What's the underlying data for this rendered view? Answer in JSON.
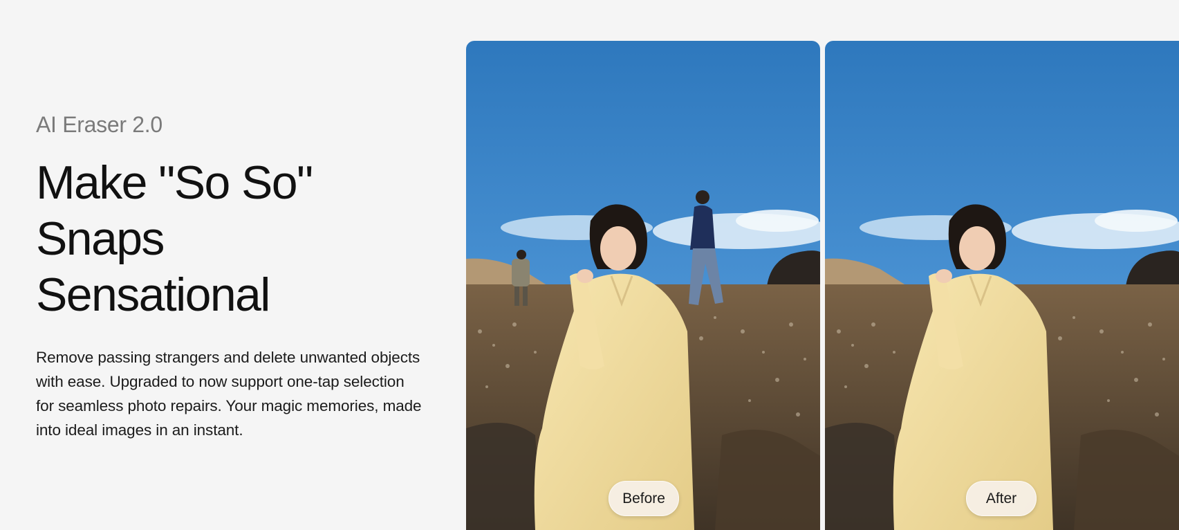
{
  "hero": {
    "eyebrow": "AI Eraser 2.0",
    "headline": [
      "Make \"So So\"",
      "Snaps",
      "Sensational"
    ],
    "description": "Remove passing strangers and delete unwanted objects with ease. Upgraded to now support one-tap selection for seamless photo repairs. Your magic memories, made into ideal images in an instant."
  },
  "comparison": {
    "before_label": "Before",
    "after_label": "After"
  },
  "colors": {
    "sky_top": "#2f7cc0",
    "sky_bottom": "#8fc3ec",
    "ground": "#6b5840",
    "dress": "#f1dfa3"
  }
}
